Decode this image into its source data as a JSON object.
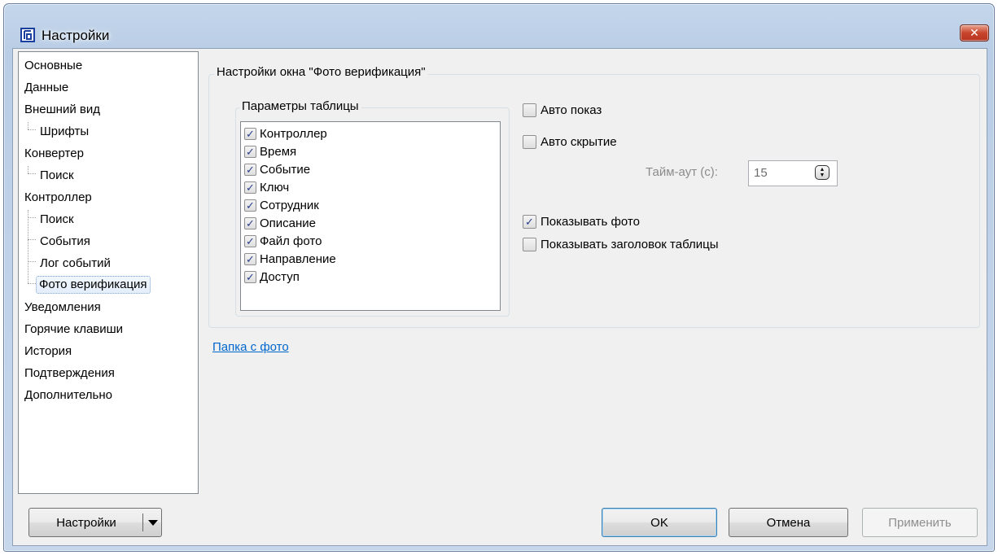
{
  "window": {
    "title": "Настройки",
    "close_glyph": "✕"
  },
  "sidebar": {
    "items": [
      {
        "label": "Основные",
        "level": 0
      },
      {
        "label": "Данные",
        "level": 0
      },
      {
        "label": "Внешний вид",
        "level": 0
      },
      {
        "label": "Шрифты",
        "level": 1
      },
      {
        "label": "Конвертер",
        "level": 0
      },
      {
        "label": "Поиск",
        "level": 1
      },
      {
        "label": "Контроллер",
        "level": 0
      },
      {
        "label": "Поиск",
        "level": 1
      },
      {
        "label": "События",
        "level": 1
      },
      {
        "label": "Лог событий",
        "level": 1
      },
      {
        "label": "Фото верификация",
        "level": 1,
        "selected": true
      },
      {
        "label": "Уведомления",
        "level": 0
      },
      {
        "label": "Горячие клавиши",
        "level": 0
      },
      {
        "label": "История",
        "level": 0
      },
      {
        "label": "Подтверждения",
        "level": 0
      },
      {
        "label": "Дополнительно",
        "level": 0
      }
    ]
  },
  "main": {
    "group_title": "Настройки окна \"Фото верификация\"",
    "table_params": {
      "title": "Параметры таблицы",
      "columns": [
        {
          "label": "Контроллер",
          "checked": true
        },
        {
          "label": "Время",
          "checked": true
        },
        {
          "label": "Событие",
          "checked": true
        },
        {
          "label": "Ключ",
          "checked": true
        },
        {
          "label": "Сотрудник",
          "checked": true
        },
        {
          "label": "Описание",
          "checked": true
        },
        {
          "label": "Файл фото",
          "checked": true
        },
        {
          "label": "Направление",
          "checked": true
        },
        {
          "label": "Доступ",
          "checked": true
        }
      ]
    },
    "auto_show": {
      "label": "Авто показ",
      "checked": false
    },
    "auto_hide": {
      "label": "Авто скрытие",
      "checked": false
    },
    "timeout": {
      "label": "Тайм-аут (с):",
      "value": "15"
    },
    "show_photo": {
      "label": "Показывать фото",
      "checked": true
    },
    "show_table_header": {
      "label": "Показывать заголовок таблицы",
      "checked": false
    },
    "photo_folder_link": "Папка с фото"
  },
  "buttons": {
    "settings": "Настройки",
    "ok": "OK",
    "cancel": "Отмена",
    "apply": "Применить"
  },
  "check_glyph": "✓",
  "colors": {
    "accent_link": "#0066cc",
    "close_red": "#c7452c",
    "selected_bg": "#e3eefb"
  }
}
